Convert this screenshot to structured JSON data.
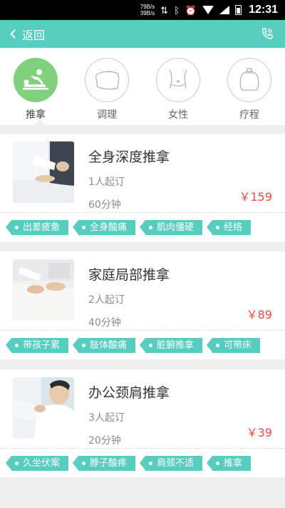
{
  "statusbar": {
    "speed_down": "79B/s",
    "speed_up": "39B/s",
    "time": "12:31"
  },
  "header": {
    "back_label": "返回"
  },
  "categories": [
    {
      "label": "推拿",
      "icon": "massage-icon",
      "active": true
    },
    {
      "label": "调理",
      "icon": "pillow-icon",
      "active": false
    },
    {
      "label": "女性",
      "icon": "torso-icon",
      "active": false
    },
    {
      "label": "疗程",
      "icon": "cupping-icon",
      "active": false
    }
  ],
  "services": [
    {
      "title": "全身深度推拿",
      "min_order": "1人起订",
      "duration": "60分钟",
      "price": "￥159",
      "tags": [
        "出差疲惫",
        "全身酸痛",
        "肌肉僵硬",
        "经络"
      ]
    },
    {
      "title": "家庭局部推拿",
      "min_order": "2人起订",
      "duration": "40分钟",
      "price": "￥89",
      "tags": [
        "带孩子累",
        "肢体酸痛",
        "脏腑推拿",
        "可带床"
      ]
    },
    {
      "title": "办公颈肩推拿",
      "min_order": "3人起订",
      "duration": "20分钟",
      "price": "￥39",
      "tags": [
        "久坐伏案",
        "脖子酸疼",
        "肩颈不适",
        "推拿"
      ]
    }
  ],
  "colors": {
    "accent": "#57cdc0",
    "active_category": "#80d17e",
    "price": "#f04848"
  }
}
